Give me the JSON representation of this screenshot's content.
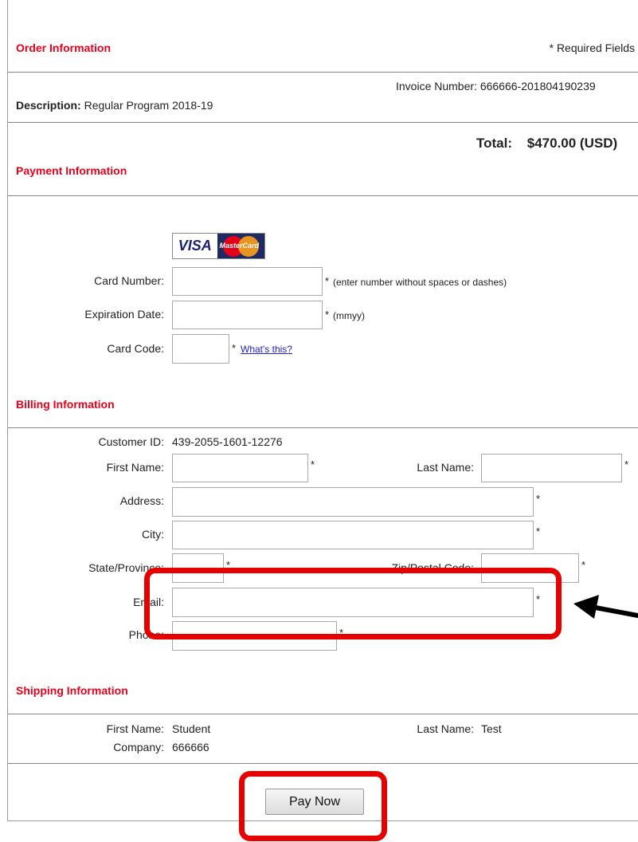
{
  "order": {
    "heading": "Order Information",
    "required_note": "* Required Fields",
    "invoice_label": "Invoice Number:",
    "invoice_value": "666666-201804190239",
    "description_label": "Description:",
    "description_value": "Regular Program 2018-19",
    "total_label": "Total:",
    "total_value": "$470.00 (USD)"
  },
  "payment": {
    "heading": "Payment Information",
    "card_logos": [
      "VISA",
      "MasterCard"
    ],
    "card_number_label": "Card Number:",
    "card_number_value": "",
    "card_number_hint": "(enter number without spaces or dashes)",
    "expiration_label": "Expiration Date:",
    "expiration_value": "",
    "expiration_hint": "(mmyy)",
    "card_code_label": "Card Code:",
    "card_code_value": "",
    "card_code_link": "What's this?",
    "asterisk": "*"
  },
  "billing": {
    "heading": "Billing Information",
    "customer_id_label": "Customer ID:",
    "customer_id_value": "439-2055-1601-12276",
    "first_name_label": "First Name:",
    "first_name_value": "",
    "last_name_label": "Last Name:",
    "last_name_value": "",
    "address_label": "Address:",
    "address_value": "",
    "city_label": "City:",
    "city_value": "",
    "state_label": "State/Province:",
    "state_value": "",
    "zip_label": "Zip/Postal Code:",
    "zip_value": "",
    "email_label": "Email:",
    "email_value": "",
    "phone_label": "Phone:",
    "phone_value": ""
  },
  "shipping": {
    "heading": "Shipping Information",
    "first_name_label": "First Name:",
    "first_name_value": "Student",
    "last_name_label": "Last Name:",
    "last_name_value": "Test",
    "company_label": "Company:",
    "company_value": "666666"
  },
  "actions": {
    "pay_now_label": "Pay Now"
  },
  "annotation": {
    "highlight_color": "#e60000",
    "arrow_color": "#000000"
  }
}
